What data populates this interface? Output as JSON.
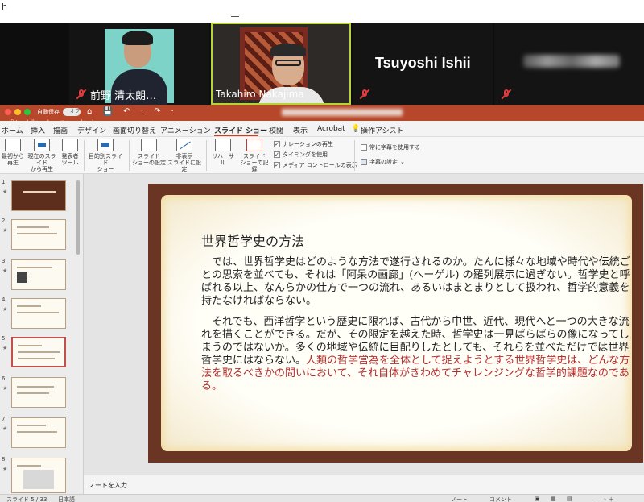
{
  "zoom": {
    "top_glyph": "h",
    "participants": [
      {
        "name": "前野 清太朗…",
        "muted": true
      },
      {
        "name": "Takahiro Nakajima",
        "muted": false,
        "active_speaker": true
      },
      {
        "name": "Tsuyoshi Ishii",
        "muted": true
      },
      {
        "name": "",
        "muted": true,
        "name_obscured": true
      }
    ]
  },
  "powerpoint": {
    "titlebar": {
      "autosave_label": "自動保存",
      "autosave_state": "オフ",
      "quick_access": "⌂ 💾 ↶ · ↷ ·",
      "overlay_text": "プレゼンしています"
    },
    "tabs": [
      "ホーム",
      "挿入",
      "描画",
      "デザイン",
      "画面切り替え",
      "アニメーション",
      "スライド ショー",
      "校閲",
      "表示",
      "Acrobat",
      "操作アシスト"
    ],
    "active_tab": "スライド ショー",
    "tell_me_icon": "lightbulb-icon",
    "ribbon": {
      "from_start": "最初から\n再生",
      "from_current": "現在のスライド\nから再生",
      "presenter": "発表者\nツール",
      "custom_show": "目的別スライド\nショー",
      "setup": "スライド\nショーの設定",
      "hide": "非表示\nスライドに設定",
      "rehearse": "リハーサル",
      "record": "スライド\nショーの記録",
      "checks": [
        "ナレーションの再生",
        "タイミングを使用",
        "メディア コントロールの表示"
      ],
      "subtitles_always": "常に字幕を使用する",
      "subtitle_settings": "字幕の設定"
    },
    "thumbnails": [
      {
        "number": "1",
        "has_star": true
      },
      {
        "number": "2",
        "has_star": true
      },
      {
        "number": "3",
        "has_star": true
      },
      {
        "number": "4",
        "has_star": true
      },
      {
        "number": "5",
        "has_star": true,
        "active": true
      },
      {
        "number": "6",
        "has_star": true
      },
      {
        "number": "7",
        "has_star": true
      },
      {
        "number": "8",
        "has_star": true
      }
    ],
    "slide": {
      "title": "世界哲学史の方法",
      "paragraph1": "では、世界哲学史はどのような方法で遂行されるのか。たんに様々な地域や時代や伝統ごとの思索を並べても、それは「阿呆の画廊」(へーゲル) の羅列展示に過ぎない。哲学史と呼ばれる以上、なんらかの仕方で一つの流れ、あるいはまとまりとして扱われ、哲学的意義を持たなければならない。",
      "paragraph2_normal": "それでも、西洋哲学という歴史に限れば、古代から中世、近代、現代へと一つの大きな流れを描くことができる。だが、その限定を越えた時、哲学史は一見ばらばらの像になってしまうのではないか。多くの地域や伝統に目配りしたとしても、それらを並べただけでは世界哲学史にはならない。",
      "paragraph2_highlight": "人類の哲学営為を全体として捉えようとする世界哲学史は、どんな方法を取るべきかの問いにおいて、それ自体がきわめてチャレンジングな哲学的課題なのである。",
      "highlight_color": "#b52c2c",
      "frame_color": "#6a3522"
    },
    "notes_placeholder": "ノートを入力",
    "status": {
      "slide_counter": "スライド 5 / 33",
      "language": "日本語",
      "notes_btn": "ノート",
      "comments_btn": "コメント"
    }
  }
}
